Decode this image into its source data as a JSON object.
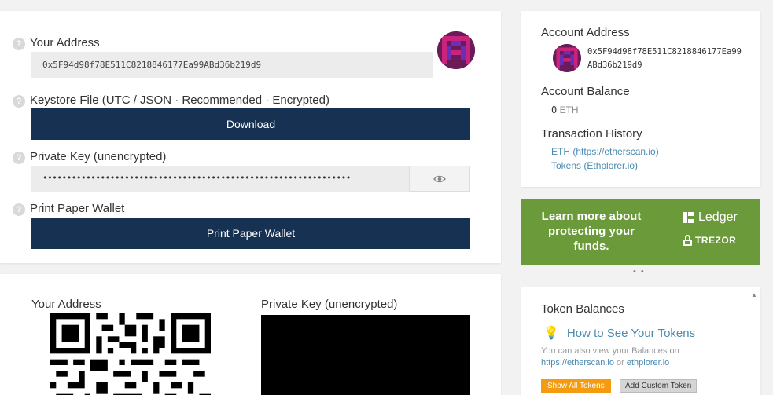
{
  "wallet": {
    "your_address_label": "Your Address",
    "address": "0x5F94d98f78E511C8218846177Ea99ABd36b219d9",
    "keystore_label": "Keystore File (UTC / JSON · Recommended · Encrypted)",
    "download_button": "Download",
    "private_key_label": "Private Key (unencrypted)",
    "private_key_masked": "••••••••••••••••••••••••••••••••••••••••••••••••••••••••••••••••",
    "print_label": "Print Paper Wallet",
    "print_button": "Print Paper Wallet",
    "help_glyph": "?",
    "eye_icon": "eye-icon"
  },
  "paper": {
    "address_label": "Your Address",
    "private_key_label": "Private Key (unencrypted)"
  },
  "account": {
    "address_title": "Account Address",
    "address": "0x5F94d98f78E511C8218846177Ea99ABd36b219d9",
    "balance_title": "Account Balance",
    "balance_value": "0",
    "balance_unit": "ETH",
    "history_title": "Transaction History",
    "history_links": [
      "ETH (https://etherscan.io)",
      "Tokens (Ethplorer.io)"
    ]
  },
  "promo": {
    "text": "Learn more about protecting your funds.",
    "ledger": "Ledger",
    "trezor": "TREZOR",
    "background": "#6b9a3a"
  },
  "tokens": {
    "title": "Token Balances",
    "how_link": "How to See Your Tokens",
    "desc_prefix": "You can also view your Balances on",
    "desc_link1": "https://etherscan.io",
    "desc_or": "or",
    "desc_link2": "ethplorer.io",
    "show_all_button": "Show All Tokens",
    "add_custom_button": "Add Custom Token",
    "accent": "#f39c12"
  },
  "colors": {
    "navy": "#163152",
    "link": "#4a8ab0"
  }
}
